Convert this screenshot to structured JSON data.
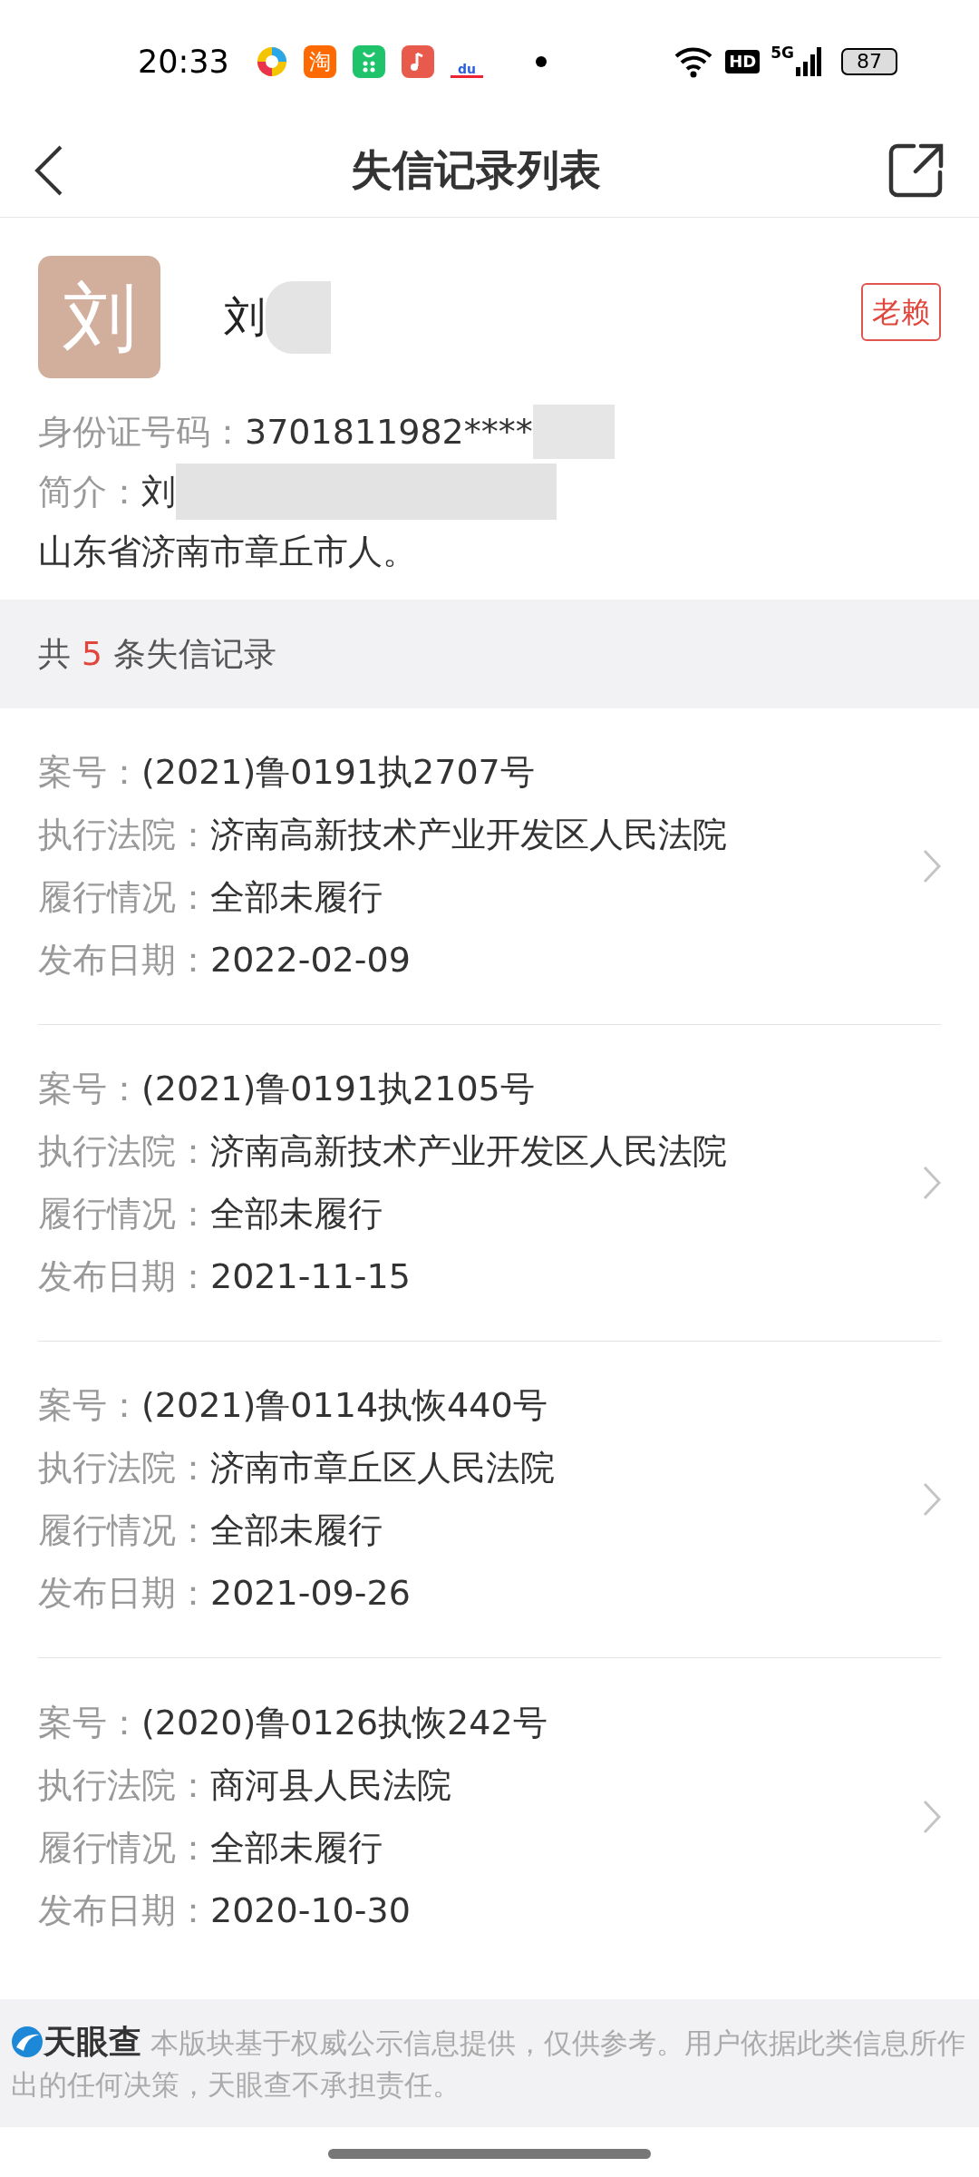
{
  "status_bar": {
    "time": "20:33",
    "taobao_icon_text": "淘",
    "baidu_icon_text": "du",
    "hd_badge": "HD",
    "network": "5G",
    "battery": "87"
  },
  "header": {
    "title": "失信记录列表"
  },
  "profile": {
    "avatar_char": "刘",
    "name": "刘",
    "tag": "老赖",
    "id_label": "身份证号码：",
    "id_value": "3701811982****",
    "intro_label": "简介：",
    "intro_start": "刘",
    "intro_end": "山东省济南市章丘市人。"
  },
  "summary": {
    "prefix": "共",
    "count": "5",
    "suffix": "条失信记录"
  },
  "records": [
    {
      "fields": [
        {
          "label": "案号：",
          "value": "(2021)鲁0191执2707号"
        },
        {
          "label": "执行法院：",
          "value": "济南高新技术产业开发区人民法院"
        },
        {
          "label": "履行情况：",
          "value": "全部未履行"
        },
        {
          "label": "发布日期：",
          "value": "2022-02-09"
        }
      ]
    },
    {
      "fields": [
        {
          "label": "案号：",
          "value": "(2021)鲁0191执2105号"
        },
        {
          "label": "执行法院：",
          "value": "济南高新技术产业开发区人民法院"
        },
        {
          "label": "履行情况：",
          "value": "全部未履行"
        },
        {
          "label": "发布日期：",
          "value": "2021-11-15"
        }
      ]
    },
    {
      "fields": [
        {
          "label": "案号：",
          "value": "(2021)鲁0114执恢440号"
        },
        {
          "label": "执行法院：",
          "value": "济南市章丘区人民法院"
        },
        {
          "label": "履行情况：",
          "value": "全部未履行"
        },
        {
          "label": "发布日期：",
          "value": "2021-09-26"
        }
      ]
    },
    {
      "fields": [
        {
          "label": "案号：",
          "value": "(2020)鲁0126执恢242号"
        },
        {
          "label": "执行法院：",
          "value": "商河县人民法院"
        },
        {
          "label": "履行情况：",
          "value": "全部未履行"
        },
        {
          "label": "发布日期：",
          "value": "2020-10-30"
        }
      ]
    }
  ],
  "footer": {
    "brand": "天眼查",
    "disclaimer": "本版块基于权威公示信息提供，仅供参考。用户依据此类信息所作出的任何决策，天眼查不承担责任。"
  }
}
